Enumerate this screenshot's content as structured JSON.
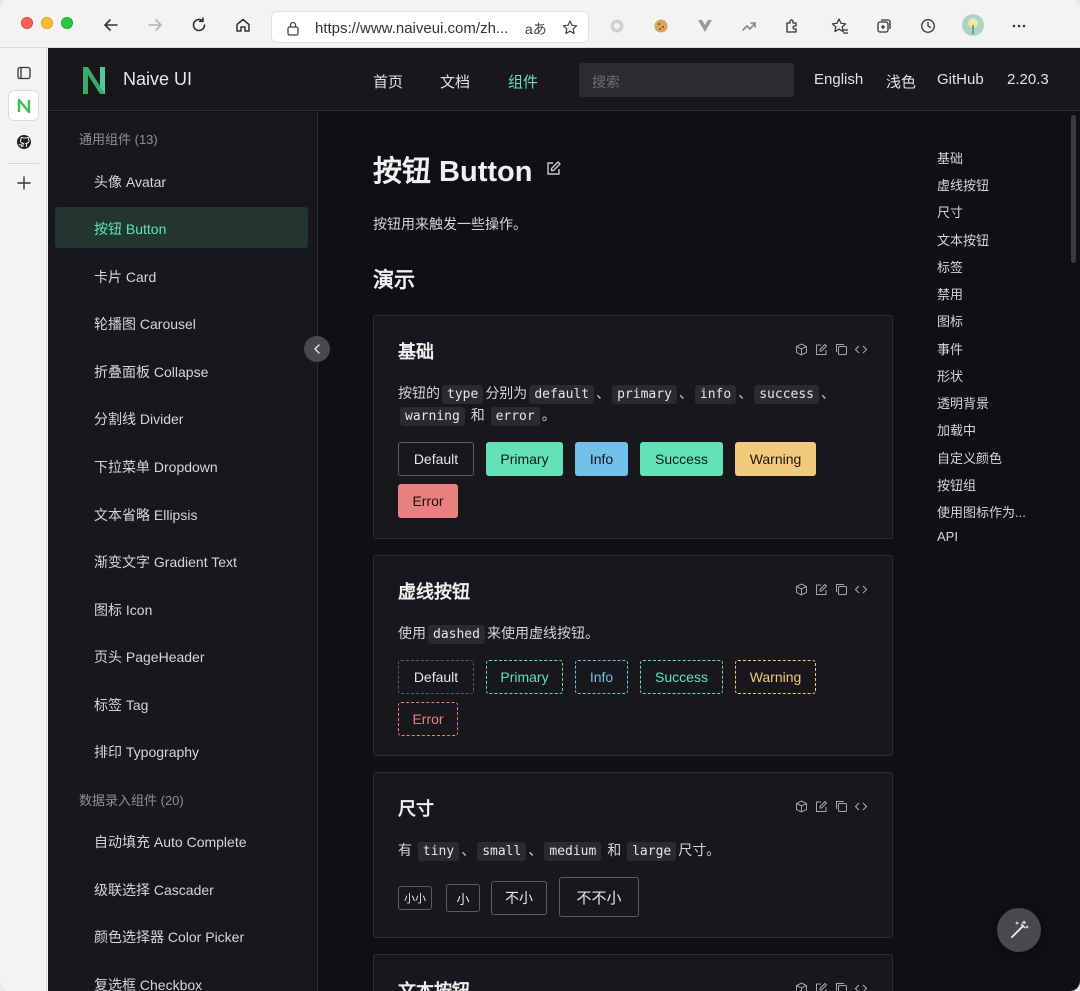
{
  "browser": {
    "url": "https://www.naiveui.com/zh...",
    "reader_icon": "aあ",
    "nav_icons": [
      "back-icon",
      "forward-icon",
      "reload-icon",
      "home-icon"
    ],
    "extension_icons": [
      "extension-icon",
      "cookie-icon",
      "vue-devtools-icon",
      "trend-icon",
      "puzzle-icon",
      "favorites-icon",
      "collections-icon",
      "history-icon",
      "profile-avatar-icon",
      "more-icon"
    ]
  },
  "header": {
    "brand": "Naive UI",
    "nav": [
      "首页",
      "文档",
      "组件"
    ],
    "search_placeholder": "搜索",
    "lang": "English",
    "theme": "浅色",
    "github": "GitHub",
    "version": "2.20.3"
  },
  "sidebar": {
    "group1": "通用组件 (13)",
    "group1_items": [
      "头像 Avatar",
      "按钮 Button",
      "卡片 Card",
      "轮播图 Carousel",
      "折叠面板 Collapse",
      "分割线 Divider",
      "下拉菜单 Dropdown",
      "文本省略 Ellipsis",
      "渐变文字 Gradient Text",
      "图标 Icon",
      "页头 PageHeader",
      "标签 Tag",
      "排印 Typography"
    ],
    "group2": "数据录入组件 (20)",
    "group2_items": [
      "自动填充 Auto Complete",
      "级联选择 Cascader",
      "颜色选择器 Color Picker",
      "复选框 Checkbox"
    ]
  },
  "content": {
    "title": "按钮 Button",
    "desc": "按钮用来触发一些操作。",
    "section": "演示",
    "cards": {
      "basic": {
        "title": "基础",
        "line1_a": "按钮的",
        "line1_code1": "type",
        "line1_b": "分别为",
        "line1_code2": "default",
        "sep": "、",
        "line1_code3": "primary",
        "line1_code4": "info",
        "line1_code5": "success",
        "line2_code1": "warning",
        "line2_and": "和",
        "line2_code2": "error",
        "line2_end": "。",
        "buttons": [
          "Default",
          "Primary",
          "Info",
          "Success",
          "Warning",
          "Error"
        ]
      },
      "dashed": {
        "title": "虚线按钮",
        "desc_a": "使用",
        "desc_code": "dashed",
        "desc_b": "来使用虚线按钮。",
        "buttons": [
          "Default",
          "Primary",
          "Info",
          "Success",
          "Warning",
          "Error"
        ]
      },
      "size": {
        "title": "尺寸",
        "desc_a": "有",
        "code1": "tiny",
        "code2": "small",
        "code3": "medium",
        "code4": "large",
        "and": "和",
        "desc_end": "尺寸。",
        "buttons": [
          "小小",
          "小",
          "不小",
          "不不小"
        ]
      },
      "text": {
        "title": "文本按钮"
      }
    }
  },
  "toc": [
    "基础",
    "虚线按钮",
    "尺寸",
    "文本按钮",
    "标签",
    "禁用",
    "图标",
    "事件",
    "形状",
    "透明背景",
    "加载中",
    "自定义颜色",
    "按钮组",
    "使用图标作为...",
    "API"
  ],
  "colors": {
    "accent": "#63e2b7",
    "info": "#70c0e8",
    "warning": "#f2c97d",
    "error": "#e88080",
    "background": "#101014"
  }
}
